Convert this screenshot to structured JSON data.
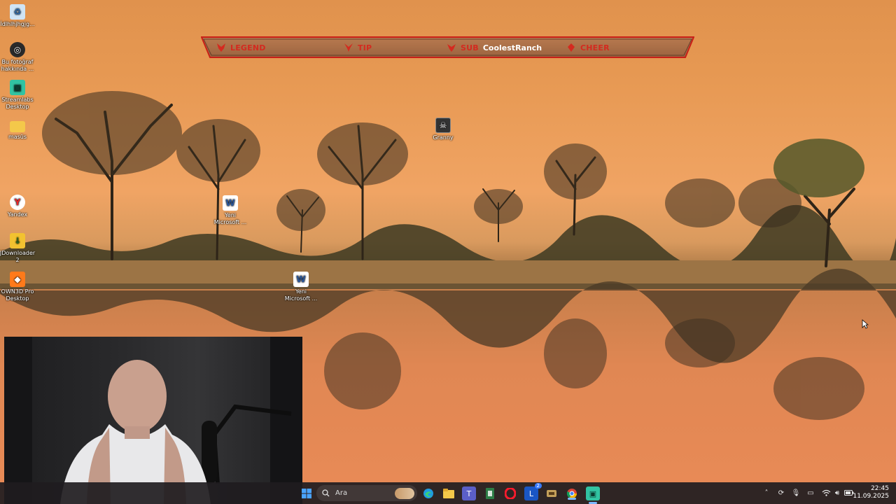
{
  "desktop_icons": [
    {
      "label": "İdlhlhjhgjg...",
      "icon": "recycle-bin-icon"
    },
    {
      "label": "Bu fotoğraf hakkında ...",
      "icon": "photo-info-icon"
    },
    {
      "label": "Streamlabs Desktop",
      "icon": "streamlabs-icon"
    },
    {
      "label": "masüs",
      "icon": "folder-icon"
    },
    {
      "label": "Yandex",
      "icon": "yandex-icon"
    },
    {
      "label": "JDownloader 2",
      "icon": "jdownloader-icon"
    },
    {
      "label": "OWN3D Pro Desktop",
      "icon": "own3d-icon"
    },
    {
      "label": "Yeni Microsoft ...",
      "icon": "word-document-icon"
    },
    {
      "label": "Yeni Microsoft ...",
      "icon": "word-document-icon"
    },
    {
      "label": "Granny",
      "icon": "granny-game-icon"
    }
  ],
  "alert_bar": {
    "legend_label": "LEGEND",
    "tip_label": "TIP",
    "sub_label": "SUB",
    "sub_user": "CoolestRanch",
    "cheer_label": "CHEER"
  },
  "taskbar": {
    "search_placeholder": "Ara",
    "badge_count": "2",
    "time": "22:45",
    "date": "11.09.2025"
  },
  "colors": {
    "alert_red": "#d42a1f",
    "taskbar_bg": "#201c20",
    "accent": "#7ab8ff"
  }
}
